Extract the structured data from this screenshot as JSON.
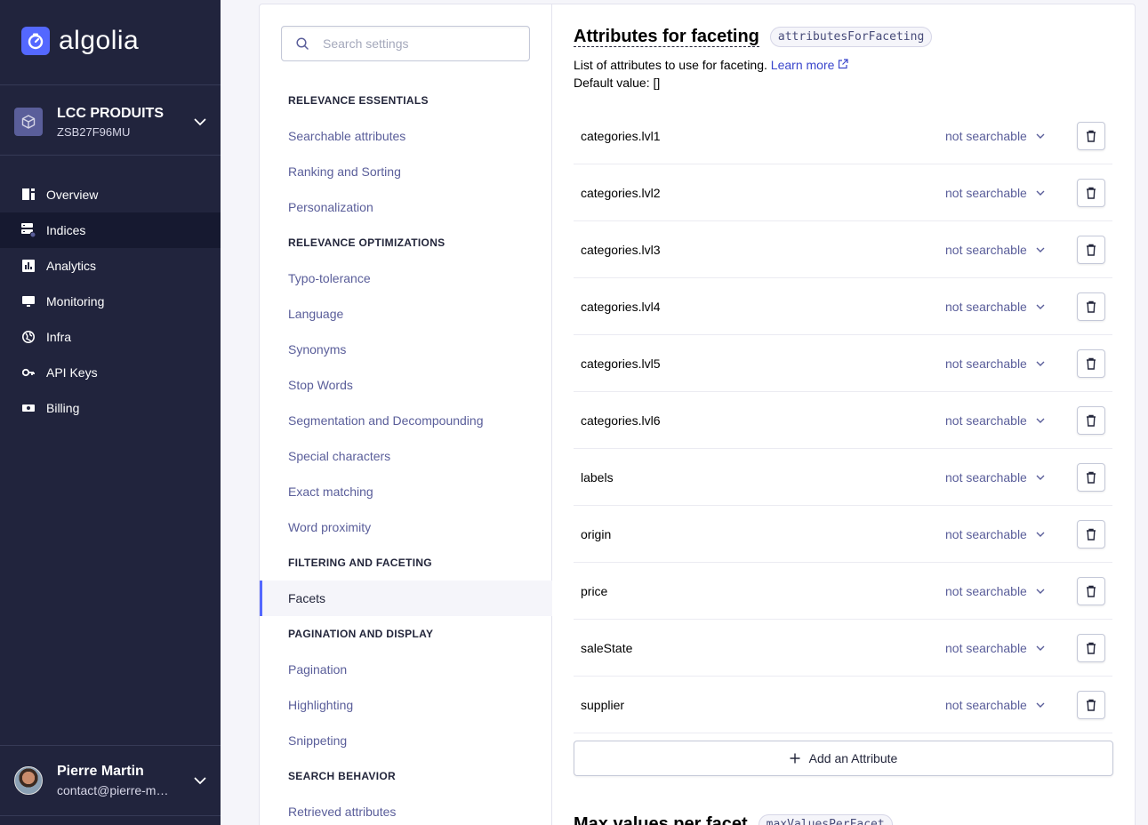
{
  "sidebar": {
    "logo_text": "algolia",
    "app": {
      "name": "LCC PRODUITS",
      "id": "ZSB27F96MU"
    },
    "nav": [
      {
        "label": "Overview",
        "icon": "overview-icon",
        "active": false
      },
      {
        "label": "Indices",
        "icon": "indices-icon",
        "active": true
      },
      {
        "label": "Analytics",
        "icon": "analytics-icon",
        "active": false
      },
      {
        "label": "Monitoring",
        "icon": "monitoring-icon",
        "active": false
      },
      {
        "label": "Infra",
        "icon": "infra-icon",
        "active": false
      },
      {
        "label": "API Keys",
        "icon": "key-icon",
        "active": false
      },
      {
        "label": "Billing",
        "icon": "billing-icon",
        "active": false
      }
    ],
    "user": {
      "name": "Pierre Martin",
      "email": "contact@pierre-martin"
    }
  },
  "settings_nav": {
    "search_placeholder": "Search settings",
    "sections": [
      {
        "heading": "RELEVANCE ESSENTIALS",
        "items": [
          "Searchable attributes",
          "Ranking and Sorting",
          "Personalization"
        ]
      },
      {
        "heading": "RELEVANCE OPTIMIZATIONS",
        "items": [
          "Typo-tolerance",
          "Language",
          "Synonyms",
          "Stop Words",
          "Segmentation and Decompounding",
          "Special characters",
          "Exact matching",
          "Word proximity"
        ]
      },
      {
        "heading": "FILTERING AND FACETING",
        "items": [
          "Facets"
        ]
      },
      {
        "heading": "PAGINATION AND DISPLAY",
        "items": [
          "Pagination",
          "Highlighting",
          "Snippeting"
        ]
      },
      {
        "heading": "SEARCH BEHAVIOR",
        "items": [
          "Retrieved attributes"
        ]
      }
    ],
    "active_item": "Facets"
  },
  "content": {
    "section1": {
      "title": "Attributes for faceting",
      "code": "attributesForFaceting",
      "description": "List of attributes to use for faceting.",
      "learn_more": "Learn more",
      "default_value": "Default value: []",
      "attributes": [
        {
          "name": "categories.lvl1",
          "mode": "not searchable"
        },
        {
          "name": "categories.lvl2",
          "mode": "not searchable"
        },
        {
          "name": "categories.lvl3",
          "mode": "not searchable"
        },
        {
          "name": "categories.lvl4",
          "mode": "not searchable"
        },
        {
          "name": "categories.lvl5",
          "mode": "not searchable"
        },
        {
          "name": "categories.lvl6",
          "mode": "not searchable"
        },
        {
          "name": "labels",
          "mode": "not searchable"
        },
        {
          "name": "origin",
          "mode": "not searchable"
        },
        {
          "name": "price",
          "mode": "not searchable"
        },
        {
          "name": "saleState",
          "mode": "not searchable"
        },
        {
          "name": "supplier",
          "mode": "not searchable"
        }
      ],
      "add_label": "Add an Attribute"
    },
    "section2": {
      "title": "Max values per facet",
      "code": "maxValuesPerFacet"
    }
  },
  "colors": {
    "sidebar_bg": "#21243d",
    "accent": "#5468ff",
    "link": "#5a5e9a"
  }
}
